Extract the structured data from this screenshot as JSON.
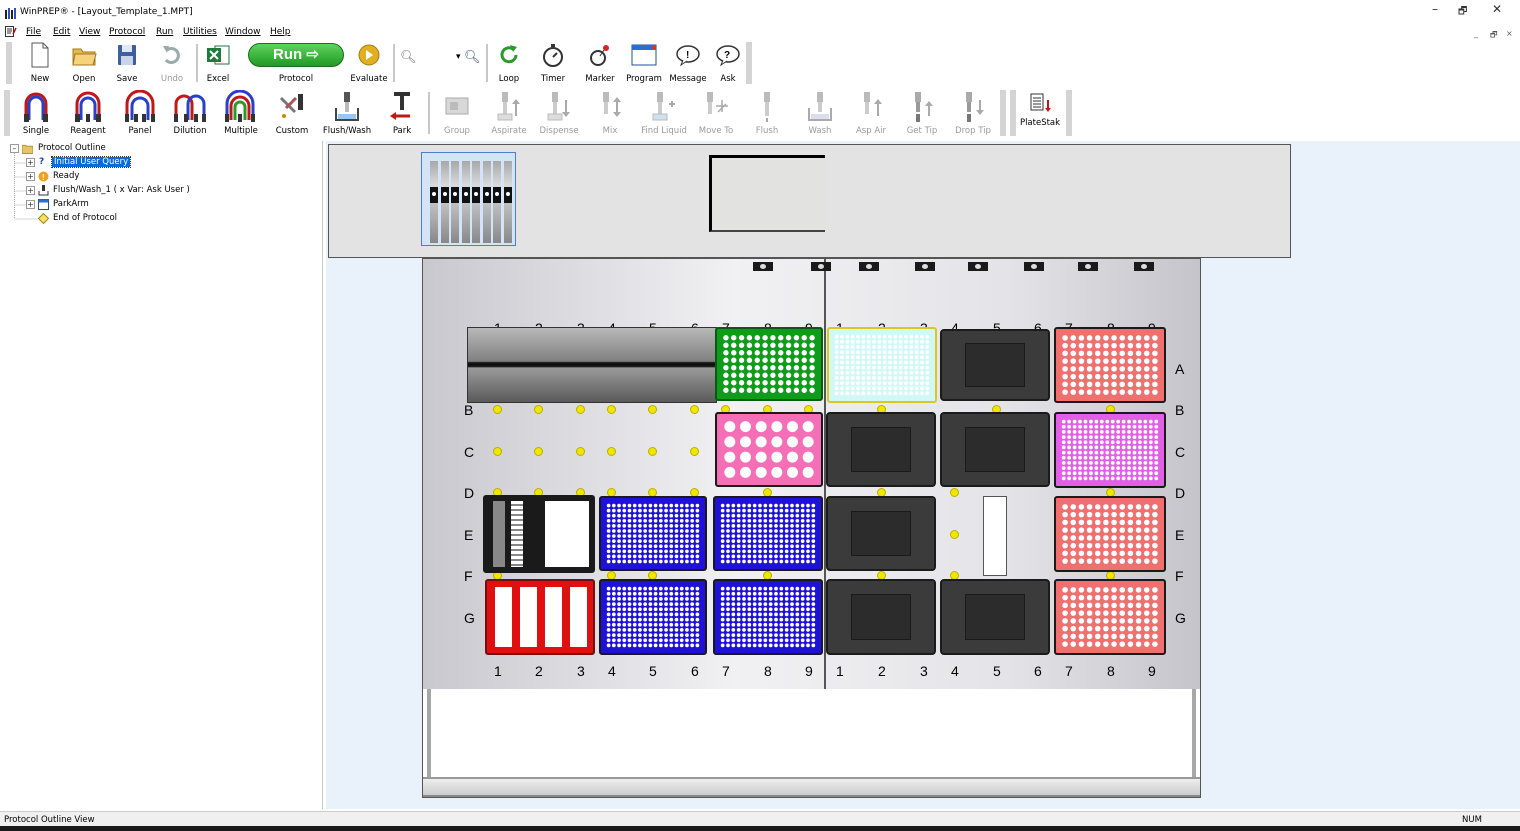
{
  "window": {
    "title": "WinPREP® - [Layout_Template_1.MPT]",
    "controls": [
      "–",
      "🗗",
      "✕"
    ],
    "mdi_controls": [
      "_",
      "🗗",
      "×"
    ]
  },
  "menu": [
    "File",
    "Edit",
    "View",
    "Protocol",
    "Run",
    "Utilities",
    "Window",
    "Help"
  ],
  "toolbar1": {
    "new": "New",
    "open": "Open",
    "save": "Save",
    "undo": "Undo",
    "excel": "Excel",
    "run_button": "Run",
    "protocol": "Protocol",
    "evaluate": "Evaluate",
    "zoom_value": "",
    "loop": "Loop",
    "timer": "Timer",
    "marker": "Marker",
    "program": "Program",
    "message": "Message",
    "ask": "Ask"
  },
  "toolbar2": {
    "single": "Single",
    "reagent": "Reagent",
    "panel": "Panel",
    "dilution": "Dilution",
    "multiple": "Multiple",
    "custom": "Custom",
    "flush_wash": "Flush/Wash",
    "park": "Park",
    "group": "Group",
    "aspirate": "Aspirate",
    "dispense": "Dispense",
    "mix": "Mix",
    "find_liquid": "Find Liquid",
    "move_to": "Move To",
    "flush": "Flush",
    "wash": "Wash",
    "asp_air": "Asp Air",
    "get_tip": "Get Tip",
    "drop_tip": "Drop Tip",
    "platestak": "PlateStak"
  },
  "tree": {
    "root": "Protocol Outline",
    "items": [
      {
        "label": "Initial User Query",
        "icon": "question-icon",
        "selected": true
      },
      {
        "label": "Ready",
        "icon": "warning-icon",
        "selected": false
      },
      {
        "label": "Flush/Wash_1 ( x Var: Ask User )",
        "icon": "flush-icon",
        "selected": false
      },
      {
        "label": "ParkArm",
        "icon": "park-window-icon",
        "selected": false
      },
      {
        "label": "End of Protocol",
        "icon": "diamond-icon",
        "selected": false
      }
    ]
  },
  "deck": {
    "columns": [
      "1",
      "2",
      "3",
      "4",
      "5",
      "6",
      "7",
      "8",
      "9"
    ],
    "rows": [
      "A",
      "B",
      "C",
      "D",
      "E",
      "F",
      "G"
    ],
    "colors": {
      "green": "#0f9c1a",
      "cyan": "#d2f7f7",
      "salmon": "#f07070",
      "pink": "#f56fb7",
      "magenta": "#e35fe8",
      "blue": "#1e12d9",
      "red": "#e01010",
      "carrier": "#3b3b3b"
    }
  },
  "status": {
    "left": "Protocol Outline View",
    "num": "NUM"
  }
}
